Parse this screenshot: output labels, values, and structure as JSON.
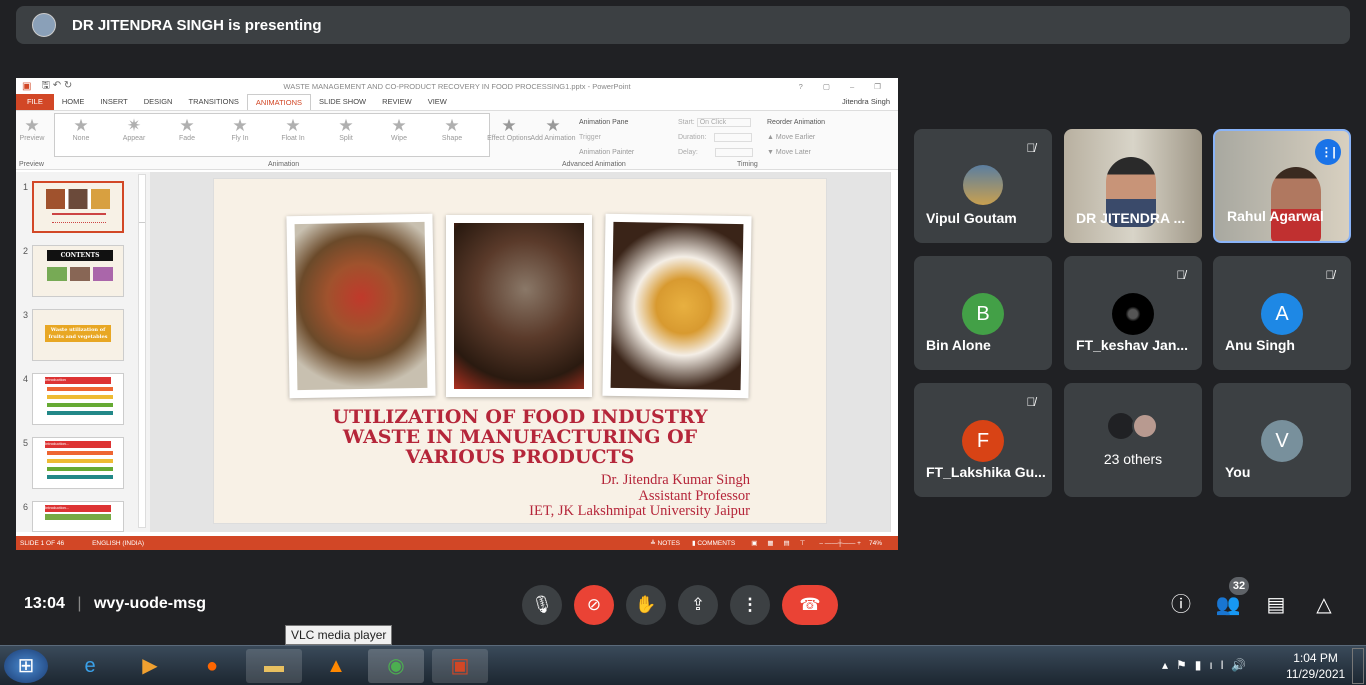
{
  "presenter_bar": {
    "text": "DR JITENDRA SINGH is presenting"
  },
  "ppt": {
    "title": "WASTE MANAGEMENT AND CO-PRODUCT RECOVERY IN FOOD PROCESSING1.pptx - PowerPoint",
    "window_buttons": [
      "?",
      "▢",
      "–",
      "❐",
      "✕"
    ],
    "tabs": [
      "FILE",
      "HOME",
      "INSERT",
      "DESIGN",
      "TRANSITIONS",
      "ANIMATIONS",
      "SLIDE SHOW",
      "REVIEW",
      "VIEW"
    ],
    "user": "Jitendra Singh",
    "preview": "Preview",
    "effects": [
      "None",
      "Appear",
      "Fade",
      "Fly In",
      "Float In",
      "Split",
      "Wipe",
      "Shape"
    ],
    "effect_options": "Effect Options",
    "add_animation": "Add Animation",
    "animation_pane": "Animation Pane",
    "trigger": "Trigger",
    "animation_painter": "Animation Painter",
    "start_label": "Start:",
    "start_value": "On Click",
    "duration_label": "Duration:",
    "delay_label": "Delay:",
    "reorder": "Reorder Animation",
    "move_earlier": "Move Earlier",
    "move_later": "Move Later",
    "groups": [
      "Preview",
      "Animation",
      "Advanced Animation",
      "Timing"
    ],
    "thumbs": [
      {
        "n": "1",
        "text": ""
      },
      {
        "n": "2",
        "text": "CONTENTS"
      },
      {
        "n": "3",
        "text": "Waste utilization of fruits and vegetables"
      },
      {
        "n": "4",
        "text": "Introduction"
      },
      {
        "n": "5",
        "text": "Introduction..."
      },
      {
        "n": "6",
        "text": "Introduction..."
      }
    ],
    "slide": {
      "title": "UTILIZATION OF FOOD INDUSTRY\nWASTE IN MANUFACTURING OF\nVARIOUS  PRODUCTS",
      "author": "Dr. Jitendra Kumar Singh",
      "role": "Assistant Professor",
      "org": "IET, JK Lakshmipat University Jaipur"
    },
    "status": {
      "slide": "SLIDE 1 OF 46",
      "lang": "ENGLISH (INDIA)",
      "notes": "NOTES",
      "comments": "COMMENTS",
      "zoom": "74%"
    },
    "accent": "#d24726"
  },
  "participants": [
    {
      "name": "Vipul Goutam",
      "muted": true,
      "type": "photo"
    },
    {
      "name": "DR JITENDRA ...",
      "muted": false,
      "type": "video"
    },
    {
      "name": "Rahul Agarwal",
      "muted": false,
      "speaking": true,
      "type": "video"
    },
    {
      "name": "Bin Alone",
      "initial": "B",
      "color": "#43a047",
      "muted": false
    },
    {
      "name": "FT_keshav Jan...",
      "muted": true,
      "type": "photo"
    },
    {
      "name": "Anu Singh",
      "initial": "A",
      "color": "#1e88e5",
      "muted": true
    },
    {
      "name": "FT_Lakshika Gu...",
      "initial": "F",
      "color": "#d84315",
      "muted": true
    },
    {
      "name": "23 others",
      "type": "group"
    },
    {
      "name": "You",
      "initial": "V",
      "color": "#78909c",
      "muted": false
    }
  ],
  "meeting": {
    "time": "13:04",
    "code": "wvy-uode-msg",
    "people_count": "32"
  },
  "tooltip": "VLC media player",
  "tray": {
    "time": "1:04 PM",
    "date": "11/29/2021"
  }
}
